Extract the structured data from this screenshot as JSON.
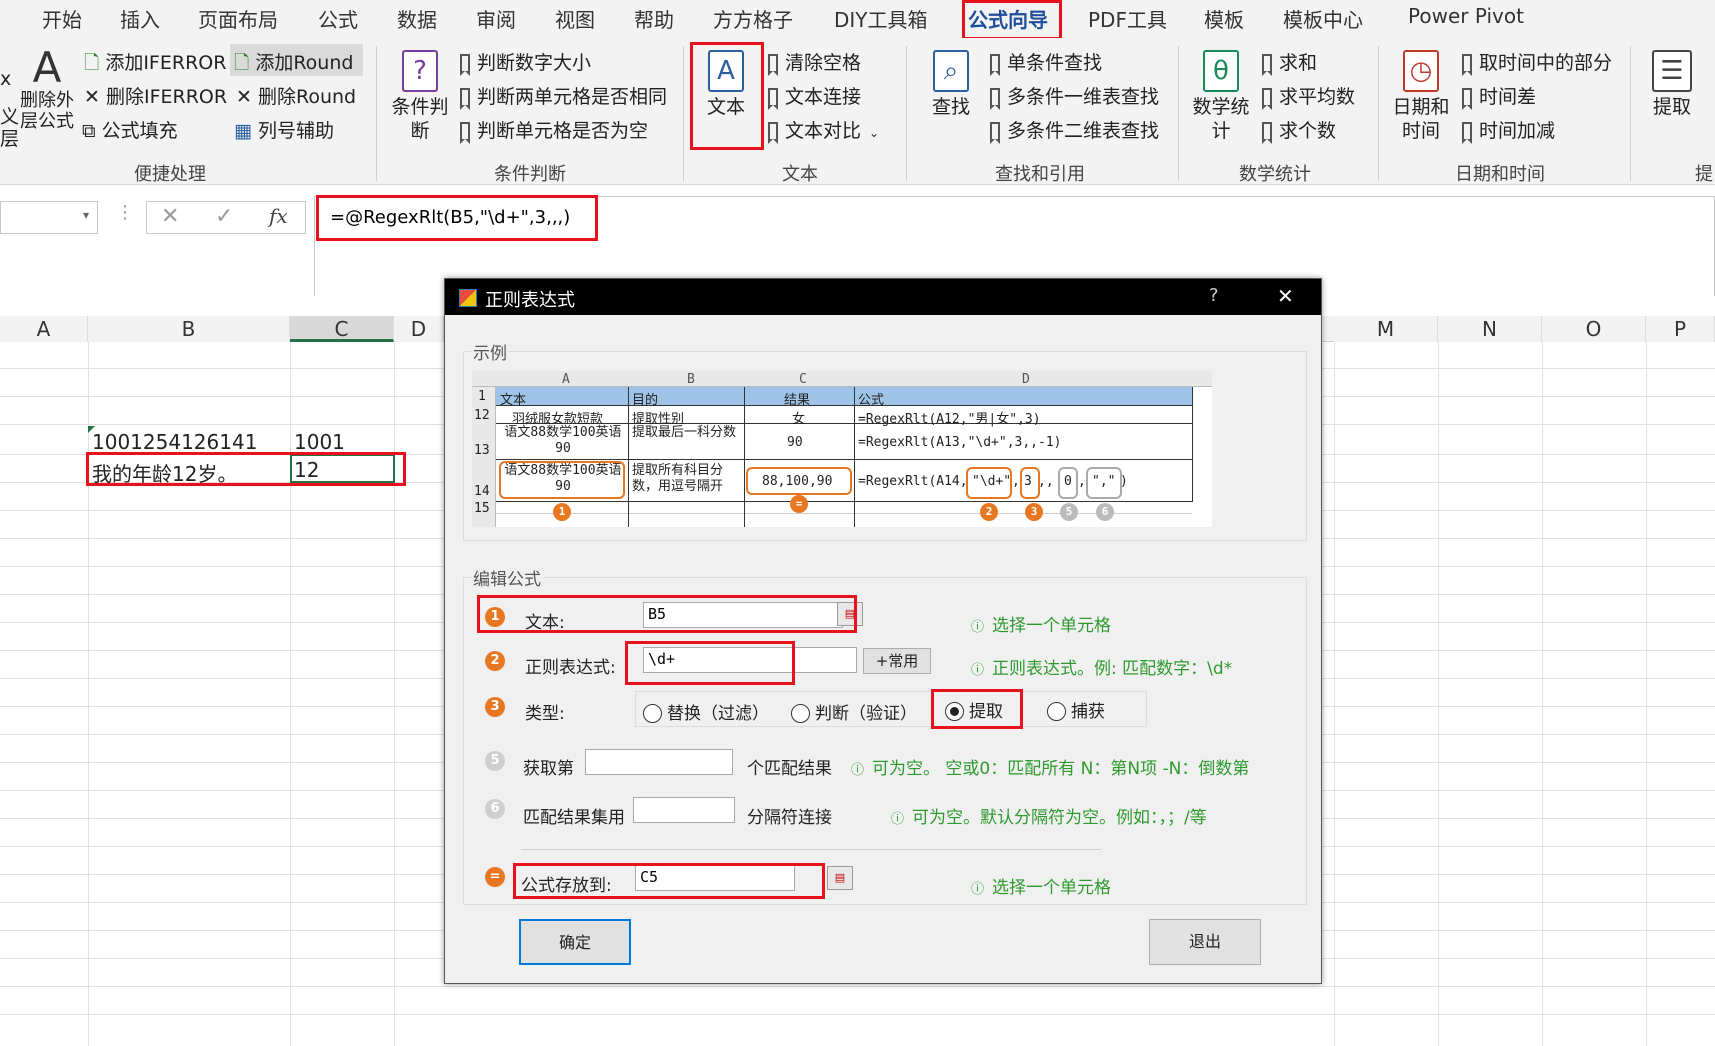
{
  "tabs": [
    "开始",
    "插入",
    "页面布局",
    "公式",
    "数据",
    "审阅",
    "视图",
    "帮助",
    "方方格子",
    "DIY工具箱",
    "公式向导",
    "PDF工具",
    "模板",
    "模板中心",
    "Power Pivot"
  ],
  "ribbon": {
    "left_partial": [
      "x",
      "义",
      "层"
    ],
    "remove_outer": "删除外\n层公式",
    "g1": {
      "add_iferror": "添加IFERROR",
      "del_iferror": "删除IFERROR",
      "fill": "公式填充",
      "add_round": "添加Round",
      "del_round": "删除Round",
      "col_helper": "列号辅助",
      "label": "便捷处理"
    },
    "g2": {
      "big": "条件判\n断",
      "items": [
        "判断数字大小",
        "判断两单元格是否相同",
        "判断单元格是否为空"
      ],
      "label": "条件判断"
    },
    "g3": {
      "big": "文本",
      "items": [
        "清除空格",
        "文本连接",
        "文本对比"
      ],
      "label": "文本"
    },
    "g4": {
      "big": "查找",
      "items": [
        "单条件查找",
        "多条件一维表查找",
        "多条件二维表查找"
      ],
      "label": "查找和引用"
    },
    "g5": {
      "big": "数学统\n计",
      "items": [
        "求和",
        "求平均数",
        "求个数"
      ],
      "label": "数学统计"
    },
    "g6": {
      "big": "日期和\n时间",
      "items": [
        "取时间中的部分",
        "时间差",
        "时间加减"
      ],
      "label": "日期和时间"
    },
    "g7": {
      "big": "提取",
      "label_partial": "提"
    }
  },
  "formula_bar": {
    "fx": "fx",
    "formula": "=@RegexRlt(B5,\"\\d+\",3,,,)"
  },
  "columns": [
    "A",
    "B",
    "C",
    "D",
    "M",
    "N",
    "O",
    "P"
  ],
  "cells": {
    "b4": "1001254126141",
    "c4": "1001",
    "b5": "我的年龄12岁。",
    "c5": "12"
  },
  "dialog": {
    "title": "正则表达式",
    "help": "?",
    "close": "✕",
    "example_label": "示例",
    "example": {
      "col_headers": [
        "A",
        "B",
        "C",
        "D"
      ],
      "rows": [
        {
          "num": "1",
          "a": "文本",
          "b": "目的",
          "c": "结果",
          "d": "公式"
        },
        {
          "num": "12",
          "a": "羽绒服女款短款",
          "b": "提取性别",
          "c": "女",
          "d": "=RegexRlt(A12,\"男|女\",3)"
        },
        {
          "num": "13",
          "a": "语文88数学100英语90",
          "b": "提取最后一科分数",
          "c": "90",
          "d": "=RegexRlt(A13,\"\\d+\",3,,-1)"
        },
        {
          "num": "14",
          "a": "语文88数学100英语90",
          "b": "提取所有科目分数，用逗号隔开",
          "c": "88,100,90",
          "d": "=RegexRlt(A14,"
        },
        {
          "num": "15",
          "a": "",
          "b": "",
          "c": "",
          "d": ""
        }
      ],
      "d14_parts": [
        "\"\\d+\"",
        ",",
        "3",
        ",,",
        "0",
        ",",
        "\",\"",
        " )"
      ],
      "badges": [
        "1",
        "=",
        "2",
        "3",
        "5",
        "6"
      ]
    },
    "edit_label": "编辑公式",
    "fields": {
      "text_label": "文本:",
      "text_value": "B5",
      "regex_label": "正则表达式:",
      "regex_value": "\\d+",
      "common_btn": "+常用",
      "type_label": "类型:",
      "types": [
        "替换（过滤）",
        "判断（验证）",
        "提取",
        "捕获"
      ],
      "nth_label": "获取第",
      "nth_suffix": "个匹配结果",
      "sep_label": "匹配结果集用",
      "sep_suffix": "分隔符连接",
      "store_label": "公式存放到:",
      "store_value": "C5"
    },
    "hints": {
      "text": "选择一个单元格",
      "regex": "正则表达式。例:    匹配数字：\\d*",
      "nth": "可为空。  空或0：匹配所有   N：第N项   -N：倒数第",
      "sep": "可为空。默认分隔符为空。例如：，；/等",
      "store": "选择一个单元格"
    },
    "badges": [
      "1",
      "2",
      "3",
      "5",
      "6",
      "="
    ],
    "ok": "确定",
    "exit": "退出"
  }
}
